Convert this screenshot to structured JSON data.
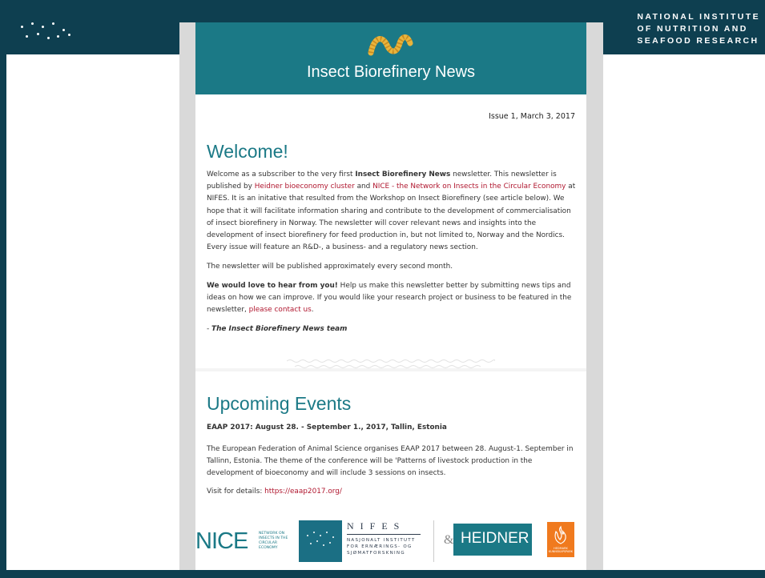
{
  "header": {
    "institute_lines": [
      "NATIONAL INSTITUTE",
      "OF NUTRITION AND",
      "SEAFOOD RESEARCH"
    ]
  },
  "newsletter": {
    "title": "Insect Biorefinery News",
    "issue": "Issue 1, March 3, 2017",
    "welcome": {
      "heading": "Welcome!",
      "p1": {
        "t1": "Welcome as a subscriber to the very first ",
        "b1": "Insect Biorefinery News",
        "t2": " newsletter. This newsletter is published by ",
        "link1": "Heidner bioeconomy cluster",
        "t3": " and ",
        "link2": "NICE - the Network on Insects in the Circular Economy",
        "t4": " at NIFES. It is an initative that resulted from the Workshop on Insect Biorefinery (see article below). We hope that it will facilitate information sharing and contribute to the development of commercialisation of insect biorefinery in Norway. The newsletter will cover relevant news and insights into the development of insect biorefinery for feed production in, but not limited to, Norway and the Nordics. Every issue will feature an R&D-, a business- and a regulatory news section."
      },
      "p2": "The newsletter will be published approximately every second month.",
      "p3": {
        "b1": "We would love to hear from you!",
        "t1": " Help us make this newsletter better by submitting news tips and ideas on how we can improve. If you would like your research project or business to be featured in the newsletter, ",
        "link": "please contact us",
        "t2": "."
      },
      "sign_prefix": "- ",
      "sign": "The Insect Biorefinery News team"
    },
    "events": {
      "heading": "Upcoming Events",
      "event_title": "EAAP 2017: August 28. - September 1., 2017, Tallin, Estonia",
      "event_body": "The European Federation of Animal Science organises EAAP 2017 between 28. August-1. September in Tallinn, Estonia. The theme of the conference will be 'Patterns of livestock production in the development of bioeconomy and will include 3 sessions on insects.",
      "visit_label": "Visit for details: ",
      "visit_link": "https://eaap2017.org/"
    }
  },
  "logos": {
    "nice": "NICE",
    "nice_small": "NETWORK ON INSECTS IN THE CIRCULAR ECONOMY",
    "nifes": "NIFES",
    "nifes_sub": [
      "NASJONALT INSTITUTT",
      "FOR ERNÆRINGS- OG",
      "SJØMATFORSKNING"
    ],
    "amp": "&",
    "heidner": "HEIDNER",
    "orange_text": "HEDMARK KUNNSKAPSPARK"
  },
  "colors": {
    "frame": "#0e3f50",
    "teal": "#1b7986",
    "link_red": "#b0172f"
  }
}
